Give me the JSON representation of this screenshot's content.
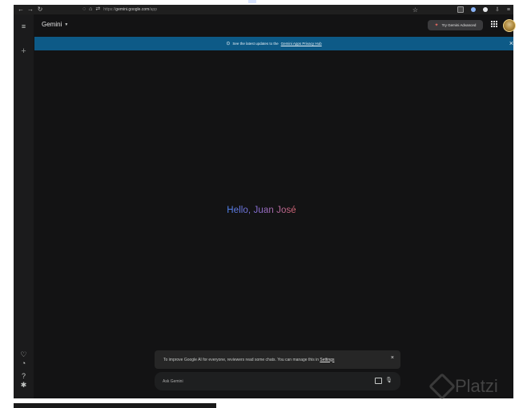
{
  "browser": {
    "url_prefix": "https://",
    "url_host": "gemini.google.com",
    "url_path": "/app"
  },
  "header": {
    "brand": "Gemini",
    "try_advanced_label": "Try Gemini Advanced"
  },
  "banner": {
    "text": "See the latest updates to the",
    "link_text": "Gemini Apps Privacy Hub"
  },
  "greeting": "Hello, Juan José",
  "notice": {
    "text": "To improve Google AI for everyone, reviewers read some chats. You can manage this in",
    "link_text": "Settings",
    "close": "×"
  },
  "prompt": {
    "placeholder": "Ask Gemini"
  },
  "watermark": {
    "text": "Platzi"
  },
  "icons": {
    "menu": "menu-icon",
    "new_chat": "plus-icon",
    "saved": "heart-icon",
    "activity": "history-icon",
    "help": "help-icon",
    "settings": "gear-icon",
    "apps": "apps-grid-icon",
    "image": "image-icon",
    "mic": "mic-icon"
  },
  "colors": {
    "background": "#131314",
    "banner": "#0d5a87",
    "greeting_start": "#4e82ee",
    "greeting_end": "#d96570"
  }
}
